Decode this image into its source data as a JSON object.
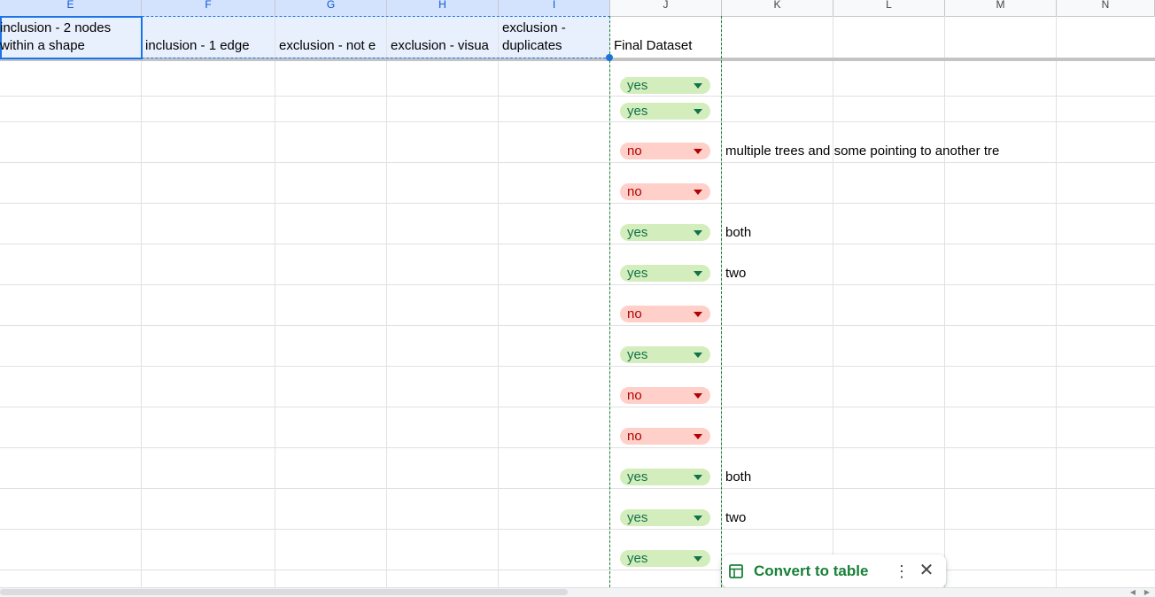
{
  "columns": [
    "E",
    "F",
    "G",
    "H",
    "I",
    "J",
    "K",
    "L",
    "M",
    "N"
  ],
  "header_row": {
    "e_line1": "inclusion - 2 nodes",
    "e_line2": "within a shape",
    "f": "inclusion - 1 edge",
    "g": "exclusion - not e",
    "h": "exclusion - visua",
    "i_line1": "exclusion -",
    "i_line2": "duplicates",
    "j": "Final Dataset"
  },
  "rows": [
    {
      "value": "yes",
      "note": ""
    },
    {
      "value": "yes",
      "note": ""
    },
    {
      "value": "no",
      "note": "multiple trees and some pointing to another tre"
    },
    {
      "value": "no",
      "note": ""
    },
    {
      "value": "yes",
      "note": "both"
    },
    {
      "value": "yes",
      "note": "two"
    },
    {
      "value": "no",
      "note": ""
    },
    {
      "value": "yes",
      "note": ""
    },
    {
      "value": "no",
      "note": ""
    },
    {
      "value": "no",
      "note": ""
    },
    {
      "value": "yes",
      "note": "both"
    },
    {
      "value": "yes",
      "note": "two"
    },
    {
      "value": "yes",
      "note": ""
    }
  ],
  "toast": {
    "label": "Convert to table",
    "icon": "table-icon",
    "more_icon": "more-vert-icon",
    "close_icon": "close-icon"
  },
  "colors": {
    "yes_bg": "#d4edbc",
    "yes_text": "#11734b",
    "no_bg": "#ffcfc9",
    "no_text": "#b10202",
    "selection": "#1a73e8",
    "accent_green": "#188038"
  }
}
